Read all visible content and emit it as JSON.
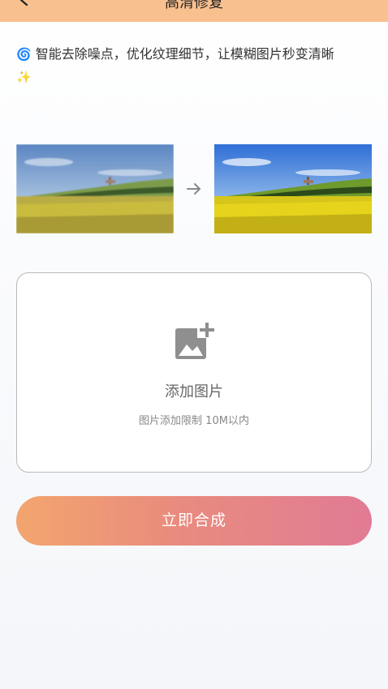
{
  "header": {
    "title": "高清修复",
    "background": "#f9c08f"
  },
  "tagline": {
    "lead_emoji": "🌀",
    "text": "智能去除噪点，优化纹理细节，让模糊图片秒变清晰",
    "trail_emoji": "✨"
  },
  "comparison": {
    "before_icon": "landscape-blurry-image",
    "arrow_icon": "arrow-right-icon",
    "after_icon": "landscape-sharp-image"
  },
  "upload": {
    "icon": "add-photo-icon",
    "label": "添加图片",
    "hint": "图片添加限制 10M以内"
  },
  "submit": {
    "label": "立即合成",
    "gradient_start": "#f3a56e",
    "gradient_end": "#e17b95"
  }
}
